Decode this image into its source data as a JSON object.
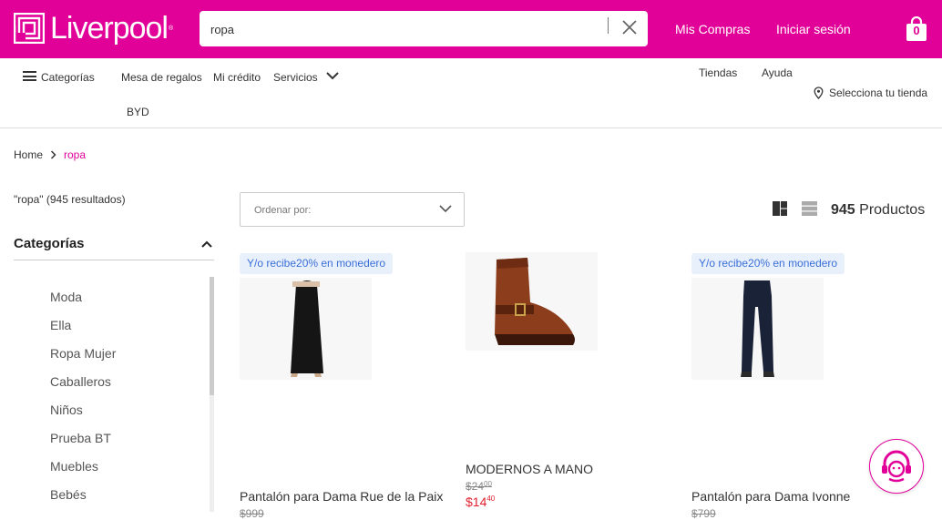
{
  "header": {
    "logo_text": "Liverpool",
    "search": {
      "value": "ropa"
    },
    "my_purchases": "Mis Compras",
    "sign_in": "Iniciar sesión",
    "cart_count": "0",
    "colors": {
      "brand": "#e10098"
    }
  },
  "nav": {
    "categories": "Categorías",
    "gift_registry": "Mesa de regalos",
    "my_credit": "Mi crédito",
    "services": "Servicios",
    "byd": "BYD",
    "stores": "Tiendas",
    "help": "Ayuda",
    "select_store": "Selecciona tu tienda"
  },
  "breadcrumb": {
    "home": "Home",
    "current": "ropa"
  },
  "results_text": "\"ropa\" (945 resultados)",
  "sidebar": {
    "title": "Categorías",
    "items": [
      "Moda",
      "Ella",
      "Ropa Mujer",
      "Caballeros",
      "Niños",
      "Prueba BT",
      "Muebles",
      "Bebés"
    ]
  },
  "toolbar": {
    "sort_label": "Ordenar por:",
    "count_number": "945",
    "count_label": "Productos"
  },
  "products": [
    {
      "badge": "Y/o recibe20% en monedero",
      "name": "Pantalón para Dama Rue de la Paix",
      "old_price": "$999",
      "image": "black-maxi-skirt"
    },
    {
      "badge": "",
      "name": "MODERNOS A MANO",
      "old_price": "$24",
      "old_cents": "00",
      "price": "$14",
      "price_cents": "40",
      "image": "brown-leather-boot"
    },
    {
      "badge": "Y/o recibe20% en monedero",
      "name": "Pantalón para Dama Ivonne",
      "old_price": "$799",
      "image": "navy-trousers"
    }
  ]
}
